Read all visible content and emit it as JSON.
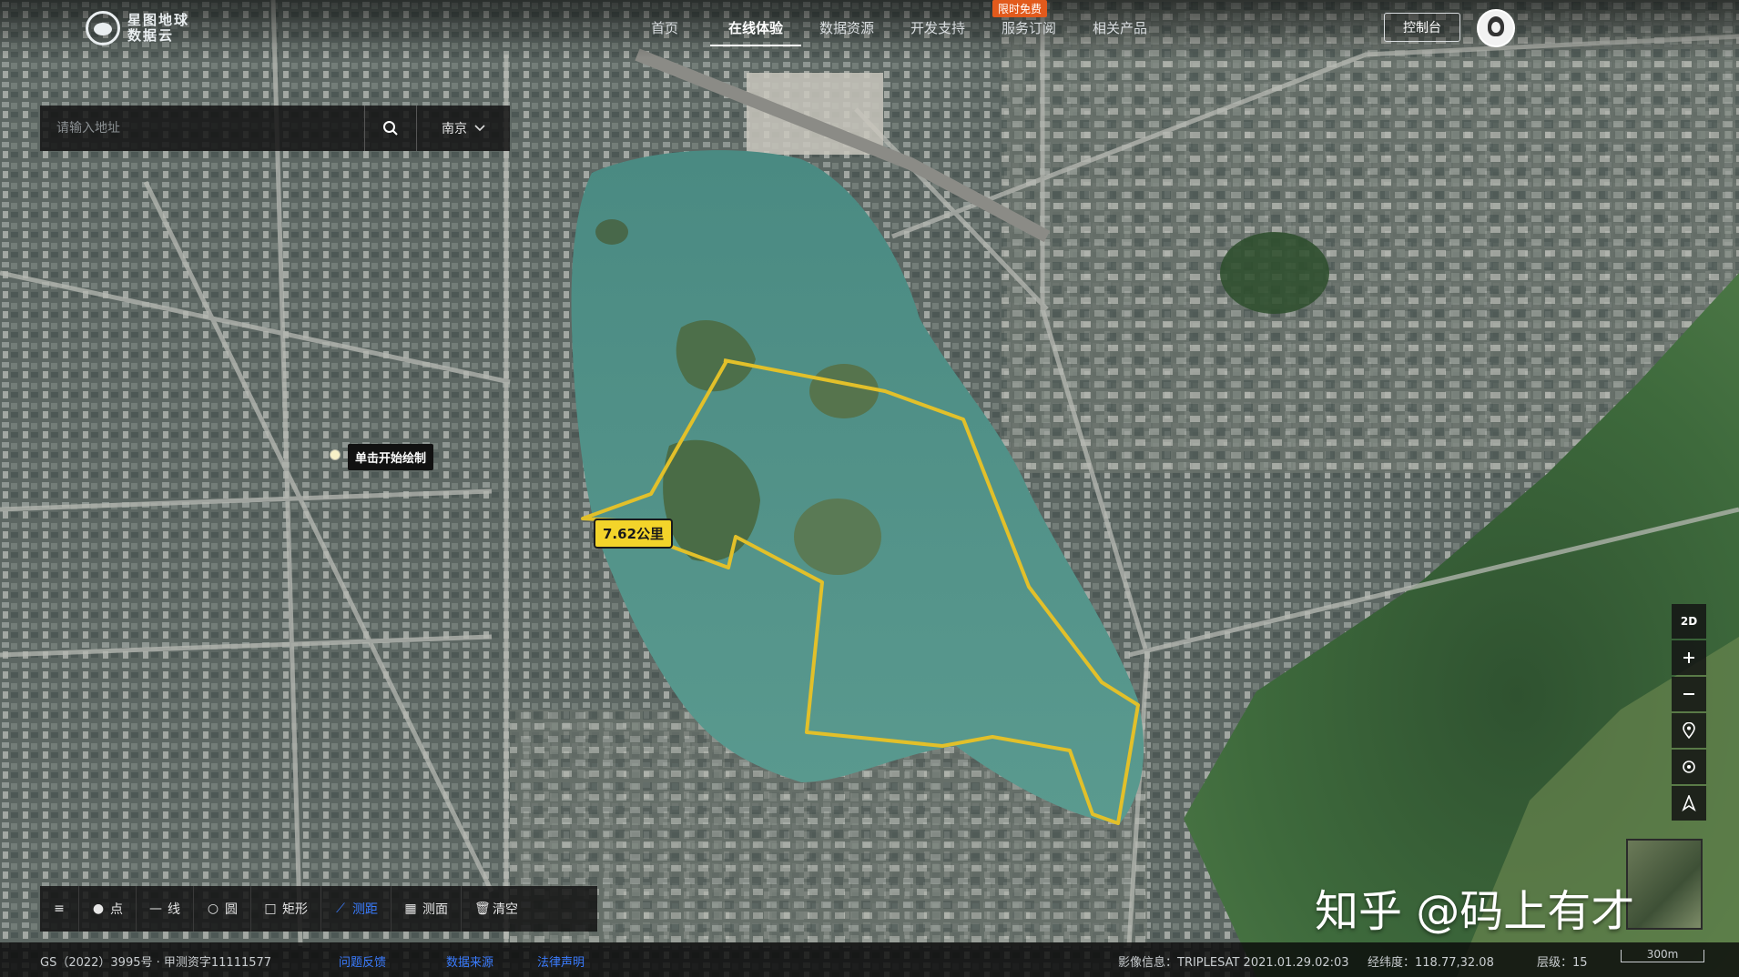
{
  "brand": {
    "line1": "星图地球",
    "line2": "数据云"
  },
  "nav": {
    "items": [
      {
        "label": "首页"
      },
      {
        "label": "在线体验"
      },
      {
        "label": "数据资源"
      },
      {
        "label": "开发支持"
      },
      {
        "label": "服务订阅"
      },
      {
        "label": "相关产品"
      }
    ],
    "active_index": 1,
    "badge": "限时免费",
    "console": "控制台"
  },
  "search": {
    "placeholder": "请输入地址",
    "city": "南京"
  },
  "map": {
    "hint": "单击开始绘制",
    "measure_result": "7.62公里",
    "route_color": "#e2c02a",
    "lake_color": "#4f8f86"
  },
  "controls": {
    "view_mode": "2D"
  },
  "toolbar": {
    "tools": [
      {
        "label": "点",
        "icon": "dot-icon"
      },
      {
        "label": "线",
        "icon": "line-icon"
      },
      {
        "label": "圆",
        "icon": "circle-icon"
      },
      {
        "label": "矩形",
        "icon": "rectangle-icon"
      },
      {
        "label": "测距",
        "icon": "ruler-icon"
      },
      {
        "label": "测面",
        "icon": "area-icon"
      },
      {
        "label": "清空",
        "icon": "trash-icon"
      }
    ],
    "active_tool": "测距",
    "accent": "#3a7cff"
  },
  "status": {
    "license": "GS（2022）3995号 · 甲测资字11111577",
    "links": [
      "问题反馈",
      "数据来源",
      "法律声明"
    ],
    "imagery": "影像信息：TRIPLESAT 2021.01.29.02:03",
    "coords": "经纬度：118.77,32.08",
    "level": "层级：15",
    "scale": "300m"
  },
  "watermark": "知乎 @码上有才"
}
